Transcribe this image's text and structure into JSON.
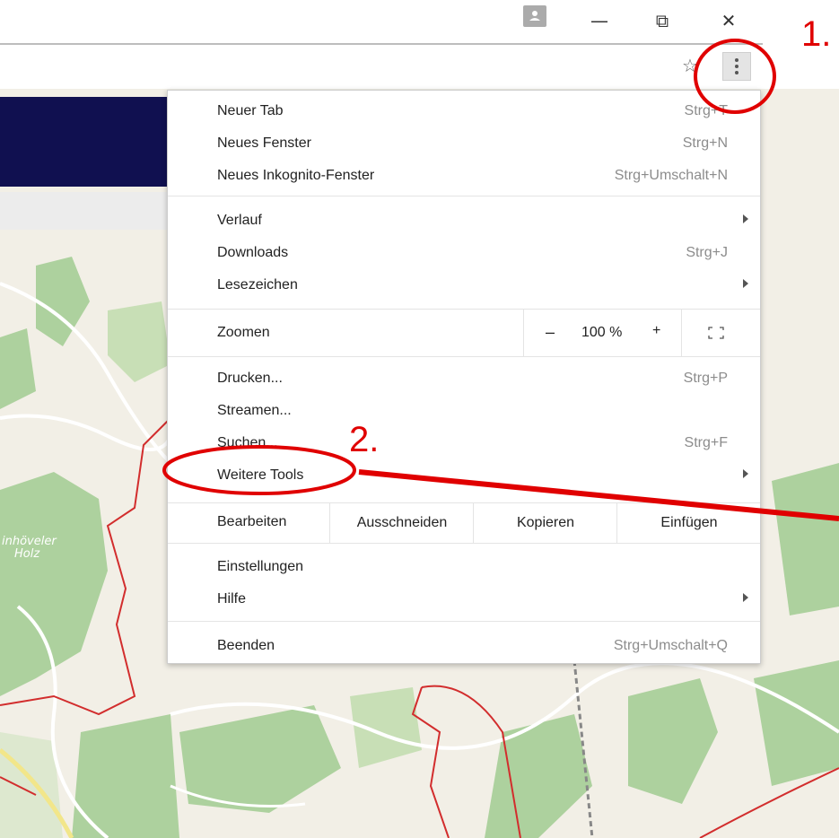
{
  "window": {
    "buttons": {
      "minimize": "—",
      "restore": "⧉",
      "close": "✕"
    }
  },
  "toolbar": {
    "bookmark_icon": "star-icon",
    "menu_icon": "kebab-icon"
  },
  "map": {
    "place_label_line1": "inhöveler",
    "place_label_line2": "Holz"
  },
  "menu": {
    "items": {
      "new_tab": {
        "label": "Neuer Tab",
        "shortcut": "Strg+T"
      },
      "new_window": {
        "label": "Neues Fenster",
        "shortcut": "Strg+N"
      },
      "incognito": {
        "label": "Neues Inkognito-Fenster",
        "shortcut": "Strg+Umschalt+N"
      },
      "history": {
        "label": "Verlauf"
      },
      "downloads": {
        "label": "Downloads",
        "shortcut": "Strg+J"
      },
      "bookmarks": {
        "label": "Lesezeichen"
      },
      "print": {
        "label": "Drucken...",
        "shortcut": "Strg+P"
      },
      "cast": {
        "label": "Streamen..."
      },
      "find": {
        "label": "Suchen...",
        "shortcut": "Strg+F"
      },
      "more_tools": {
        "label": "Weitere Tools"
      },
      "settings": {
        "label": "Einstellungen"
      },
      "help": {
        "label": "Hilfe"
      },
      "exit": {
        "label": "Beenden",
        "shortcut": "Strg+Umschalt+Q"
      }
    },
    "zoom": {
      "label": "Zoomen",
      "minus": "–",
      "value": "100 %",
      "plus": "+"
    },
    "edit": {
      "label": "Bearbeiten",
      "cut": "Ausschneiden",
      "copy": "Kopieren",
      "paste": "Einfügen"
    }
  },
  "annotations": {
    "step1": "1.",
    "step2": "2.",
    "color": "#e00000"
  },
  "colors": {
    "site_header": "#101050",
    "map_background": "#f2efe6",
    "map_forest": "#add19e",
    "map_boundary": "#d22d2d"
  }
}
